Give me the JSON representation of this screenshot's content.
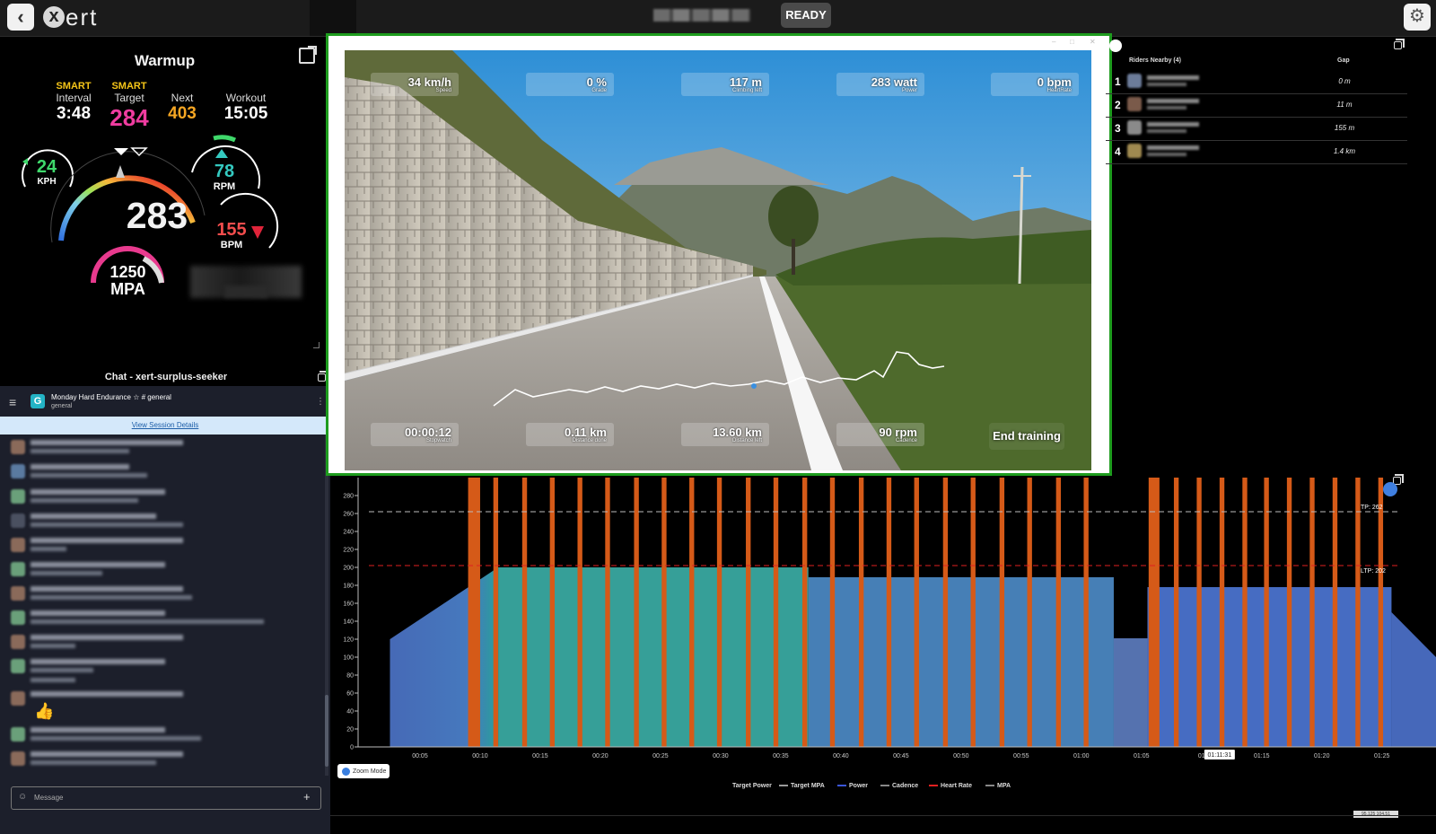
{
  "topbar": {
    "logo_letter": "x",
    "logo_text": "ert",
    "status": "READY",
    "back_icon": "chevron-left-icon",
    "settings_icon": "gear-icon"
  },
  "dashboard": {
    "title": "Warmup",
    "interval": {
      "tag": "SMART",
      "label": "Interval",
      "value": "3:48"
    },
    "target": {
      "tag": "SMART",
      "label": "Target",
      "value": "284"
    },
    "next": {
      "label": "Next",
      "value": "403"
    },
    "workout": {
      "label": "Workout",
      "value": "15:05"
    },
    "speed": {
      "value": "24",
      "unit": "KPH"
    },
    "power": {
      "value": "283"
    },
    "cadence": {
      "value": "78",
      "unit": "RPM"
    },
    "heart_rate": {
      "value": "155",
      "unit": "BPM"
    },
    "mpa": {
      "value": "1250",
      "unit": "MPA"
    },
    "colors": {
      "smart": "#f5c518",
      "target": "#f03ca0",
      "next": "#f5a623",
      "speed": "#3fd86b",
      "cadence": "#34c9c0",
      "hr": "#f34d4d"
    }
  },
  "chat": {
    "title": "Chat - xert-surplus-seeker",
    "channel_name": "Monday Hard Endurance",
    "channel_tag": "# general",
    "channel_sub": "general",
    "group_letter": "G",
    "session_link": "View Session Details",
    "input_placeholder": "Message",
    "thumbs": "👍"
  },
  "video": {
    "overlays_top": [
      {
        "value": "34 km/h",
        "label": "Speed"
      },
      {
        "value": "0 %",
        "label": "Grade"
      },
      {
        "value": "117 m",
        "label": "Climbing left"
      },
      {
        "value": "283 watt",
        "label": "Power"
      },
      {
        "value": "0 bpm",
        "label": "HeartRate"
      }
    ],
    "overlays_bottom": [
      {
        "value": "00:00:12",
        "label": "Stopwatch"
      },
      {
        "value": "0.11 km",
        "label": "Distance done"
      },
      {
        "value": "13.60 km",
        "label": "Distance left"
      },
      {
        "value": "90 rpm",
        "label": "Cadence"
      }
    ],
    "end_button": "End training"
  },
  "riders": {
    "header": "Riders Nearby (4)",
    "gap_header": "Gap",
    "list": [
      {
        "rank": "1",
        "gap": "0 m"
      },
      {
        "rank": "2",
        "gap": "11 m"
      },
      {
        "rank": "3",
        "gap": "155 m"
      },
      {
        "rank": "4",
        "gap": "1.4 km"
      }
    ]
  },
  "chart_data": {
    "type": "bar",
    "ylim": [
      0,
      300
    ],
    "y_ticks": [
      0,
      20,
      40,
      60,
      80,
      100,
      120,
      140,
      160,
      180,
      200,
      220,
      240,
      260,
      280
    ],
    "x_ticks": [
      "00:05",
      "00:10",
      "00:15",
      "00:20",
      "00:25",
      "00:30",
      "00:35",
      "00:40",
      "00:45",
      "00:50",
      "00:55",
      "01:00",
      "01:05",
      "01",
      "01:15",
      "01:20",
      "01:25",
      "00:30"
    ],
    "xlim_minutes": [
      0,
      89.5
    ],
    "reference_lines": [
      {
        "label": "TP: 262",
        "value": 262,
        "color": "#bbbbbb"
      },
      {
        "label": "LTP: 202",
        "value": 202,
        "color": "#e02020"
      }
    ],
    "target_power_segments": [
      {
        "start": 2.5,
        "end": 11.5,
        "from": 120,
        "to": 200
      },
      {
        "start": 11.5,
        "end": 37.3,
        "from": 200,
        "to": 200
      },
      {
        "start": 37.3,
        "end": 62.7,
        "from": 189,
        "to": 189
      },
      {
        "start": 62.7,
        "end": 65.5,
        "from": 121,
        "to": 121
      },
      {
        "start": 65.5,
        "end": 85.8,
        "from": 178,
        "to": 178
      },
      {
        "start": 85.8,
        "end": 89.5,
        "from": 150,
        "to": 100
      }
    ],
    "sprint_intervals": [
      {
        "start": 9.0,
        "end": 10.0
      },
      {
        "start": 11.1,
        "end": 11.5
      },
      {
        "start": 13.5,
        "end": 13.9
      },
      {
        "start": 15.8,
        "end": 16.2
      },
      {
        "start": 18.1,
        "end": 18.5
      },
      {
        "start": 20.4,
        "end": 20.8
      },
      {
        "start": 22.8,
        "end": 23.2
      },
      {
        "start": 25.1,
        "end": 25.5
      },
      {
        "start": 27.4,
        "end": 27.8
      },
      {
        "start": 29.7,
        "end": 30.1
      },
      {
        "start": 32.1,
        "end": 32.5
      },
      {
        "start": 34.4,
        "end": 34.8
      },
      {
        "start": 36.8,
        "end": 37.2
      },
      {
        "start": 39.1,
        "end": 39.5
      },
      {
        "start": 41.5,
        "end": 41.9
      },
      {
        "start": 43.8,
        "end": 44.2
      },
      {
        "start": 46.1,
        "end": 46.5
      },
      {
        "start": 48.5,
        "end": 48.9
      },
      {
        "start": 50.8,
        "end": 51.2
      },
      {
        "start": 53.2,
        "end": 53.6
      },
      {
        "start": 55.5,
        "end": 55.9
      },
      {
        "start": 57.9,
        "end": 58.3
      },
      {
        "start": 60.2,
        "end": 60.6
      },
      {
        "start": 65.6,
        "end": 66.5
      },
      {
        "start": 67.7,
        "end": 68.1
      },
      {
        "start": 69.6,
        "end": 70.0
      },
      {
        "start": 71.5,
        "end": 71.9
      },
      {
        "start": 73.4,
        "end": 73.8
      },
      {
        "start": 75.2,
        "end": 75.6
      },
      {
        "start": 77.1,
        "end": 77.5
      },
      {
        "start": 79.0,
        "end": 79.4
      },
      {
        "start": 80.9,
        "end": 81.3
      },
      {
        "start": 82.8,
        "end": 83.2
      },
      {
        "start": 84.7,
        "end": 85.1
      }
    ],
    "cursor_label": "01:11:31",
    "legend": [
      {
        "name": "Target Power",
        "color": "#e06020"
      },
      {
        "name": "Target MPA",
        "color": "#9a9a9a"
      },
      {
        "name": "Power",
        "color": "#3a56d8"
      },
      {
        "name": "Cadence",
        "color": "#888888"
      },
      {
        "name": "Heart Rate",
        "color": "#e02020"
      },
      {
        "name": "MPA",
        "color": "#888888"
      }
    ],
    "zoom_mode_label": "Zoom Mode",
    "coordinate_readout": "95.125 104.51"
  }
}
